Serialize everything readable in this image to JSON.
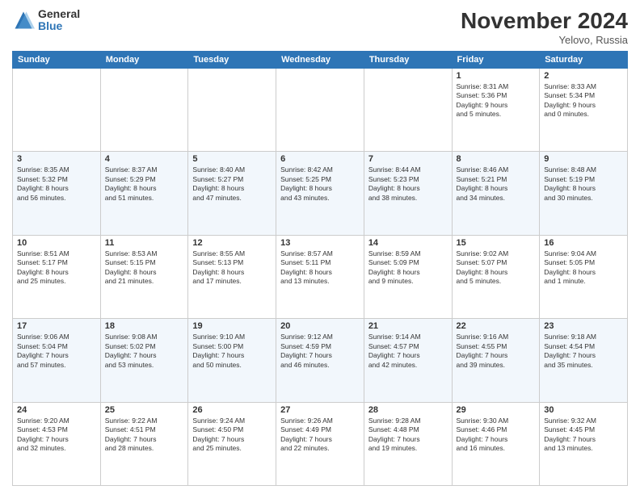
{
  "logo": {
    "general": "General",
    "blue": "Blue"
  },
  "title": {
    "month": "November 2024",
    "location": "Yelovo, Russia"
  },
  "headers": [
    "Sunday",
    "Monday",
    "Tuesday",
    "Wednesday",
    "Thursday",
    "Friday",
    "Saturday"
  ],
  "weeks": [
    [
      {
        "day": "",
        "info": ""
      },
      {
        "day": "",
        "info": ""
      },
      {
        "day": "",
        "info": ""
      },
      {
        "day": "",
        "info": ""
      },
      {
        "day": "",
        "info": ""
      },
      {
        "day": "1",
        "info": "Sunrise: 8:31 AM\nSunset: 5:36 PM\nDaylight: 9 hours\nand 5 minutes."
      },
      {
        "day": "2",
        "info": "Sunrise: 8:33 AM\nSunset: 5:34 PM\nDaylight: 9 hours\nand 0 minutes."
      }
    ],
    [
      {
        "day": "3",
        "info": "Sunrise: 8:35 AM\nSunset: 5:32 PM\nDaylight: 8 hours\nand 56 minutes."
      },
      {
        "day": "4",
        "info": "Sunrise: 8:37 AM\nSunset: 5:29 PM\nDaylight: 8 hours\nand 51 minutes."
      },
      {
        "day": "5",
        "info": "Sunrise: 8:40 AM\nSunset: 5:27 PM\nDaylight: 8 hours\nand 47 minutes."
      },
      {
        "day": "6",
        "info": "Sunrise: 8:42 AM\nSunset: 5:25 PM\nDaylight: 8 hours\nand 43 minutes."
      },
      {
        "day": "7",
        "info": "Sunrise: 8:44 AM\nSunset: 5:23 PM\nDaylight: 8 hours\nand 38 minutes."
      },
      {
        "day": "8",
        "info": "Sunrise: 8:46 AM\nSunset: 5:21 PM\nDaylight: 8 hours\nand 34 minutes."
      },
      {
        "day": "9",
        "info": "Sunrise: 8:48 AM\nSunset: 5:19 PM\nDaylight: 8 hours\nand 30 minutes."
      }
    ],
    [
      {
        "day": "10",
        "info": "Sunrise: 8:51 AM\nSunset: 5:17 PM\nDaylight: 8 hours\nand 25 minutes."
      },
      {
        "day": "11",
        "info": "Sunrise: 8:53 AM\nSunset: 5:15 PM\nDaylight: 8 hours\nand 21 minutes."
      },
      {
        "day": "12",
        "info": "Sunrise: 8:55 AM\nSunset: 5:13 PM\nDaylight: 8 hours\nand 17 minutes."
      },
      {
        "day": "13",
        "info": "Sunrise: 8:57 AM\nSunset: 5:11 PM\nDaylight: 8 hours\nand 13 minutes."
      },
      {
        "day": "14",
        "info": "Sunrise: 8:59 AM\nSunset: 5:09 PM\nDaylight: 8 hours\nand 9 minutes."
      },
      {
        "day": "15",
        "info": "Sunrise: 9:02 AM\nSunset: 5:07 PM\nDaylight: 8 hours\nand 5 minutes."
      },
      {
        "day": "16",
        "info": "Sunrise: 9:04 AM\nSunset: 5:05 PM\nDaylight: 8 hours\nand 1 minute."
      }
    ],
    [
      {
        "day": "17",
        "info": "Sunrise: 9:06 AM\nSunset: 5:04 PM\nDaylight: 7 hours\nand 57 minutes."
      },
      {
        "day": "18",
        "info": "Sunrise: 9:08 AM\nSunset: 5:02 PM\nDaylight: 7 hours\nand 53 minutes."
      },
      {
        "day": "19",
        "info": "Sunrise: 9:10 AM\nSunset: 5:00 PM\nDaylight: 7 hours\nand 50 minutes."
      },
      {
        "day": "20",
        "info": "Sunrise: 9:12 AM\nSunset: 4:59 PM\nDaylight: 7 hours\nand 46 minutes."
      },
      {
        "day": "21",
        "info": "Sunrise: 9:14 AM\nSunset: 4:57 PM\nDaylight: 7 hours\nand 42 minutes."
      },
      {
        "day": "22",
        "info": "Sunrise: 9:16 AM\nSunset: 4:55 PM\nDaylight: 7 hours\nand 39 minutes."
      },
      {
        "day": "23",
        "info": "Sunrise: 9:18 AM\nSunset: 4:54 PM\nDaylight: 7 hours\nand 35 minutes."
      }
    ],
    [
      {
        "day": "24",
        "info": "Sunrise: 9:20 AM\nSunset: 4:53 PM\nDaylight: 7 hours\nand 32 minutes."
      },
      {
        "day": "25",
        "info": "Sunrise: 9:22 AM\nSunset: 4:51 PM\nDaylight: 7 hours\nand 28 minutes."
      },
      {
        "day": "26",
        "info": "Sunrise: 9:24 AM\nSunset: 4:50 PM\nDaylight: 7 hours\nand 25 minutes."
      },
      {
        "day": "27",
        "info": "Sunrise: 9:26 AM\nSunset: 4:49 PM\nDaylight: 7 hours\nand 22 minutes."
      },
      {
        "day": "28",
        "info": "Sunrise: 9:28 AM\nSunset: 4:48 PM\nDaylight: 7 hours\nand 19 minutes."
      },
      {
        "day": "29",
        "info": "Sunrise: 9:30 AM\nSunset: 4:46 PM\nDaylight: 7 hours\nand 16 minutes."
      },
      {
        "day": "30",
        "info": "Sunrise: 9:32 AM\nSunset: 4:45 PM\nDaylight: 7 hours\nand 13 minutes."
      }
    ]
  ]
}
